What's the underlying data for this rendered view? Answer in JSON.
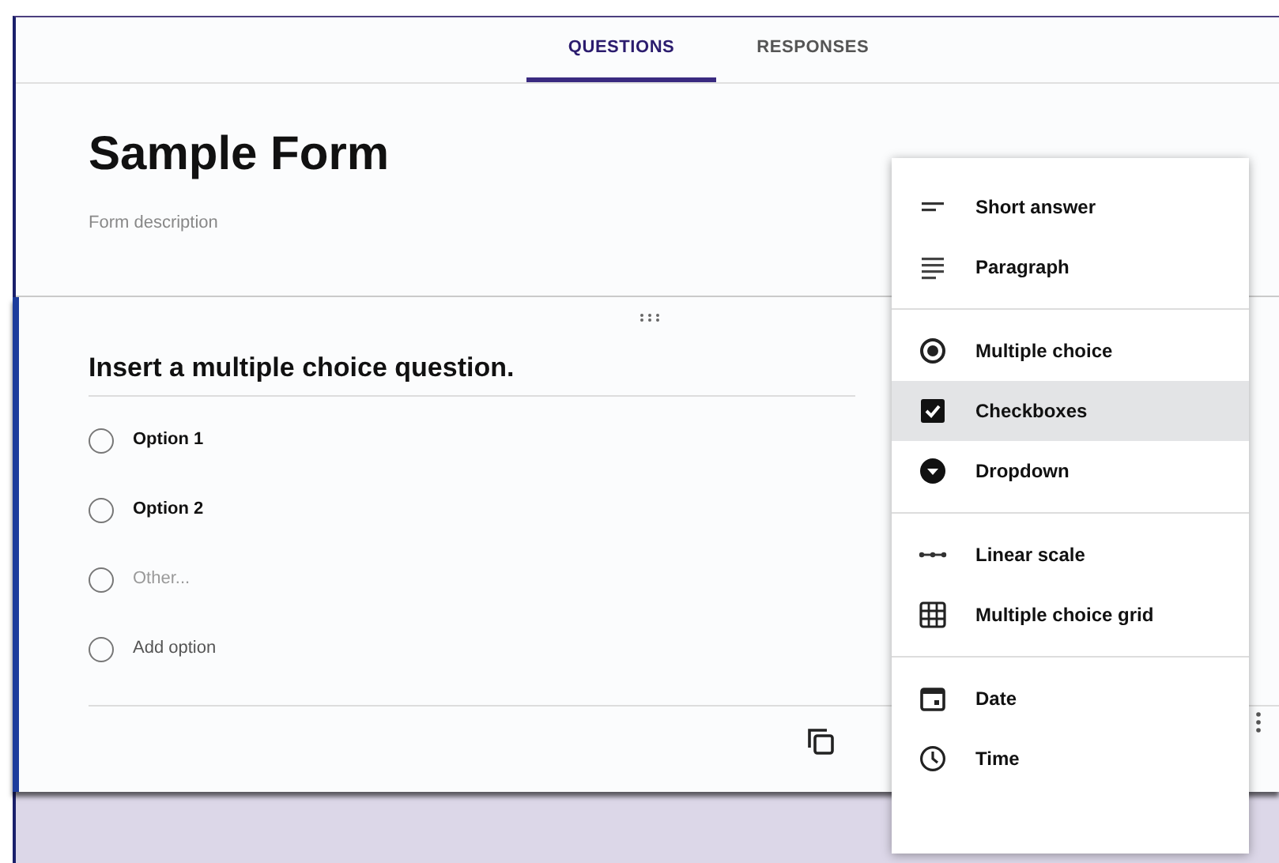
{
  "tabs": [
    {
      "label": "QUESTIONS",
      "selected": true
    },
    {
      "label": "RESPONSES",
      "selected": false
    }
  ],
  "form": {
    "title": "Sample Form",
    "description": "Form description"
  },
  "question": {
    "title": "Insert a multiple choice question.",
    "options": [
      {
        "label": "Option 1",
        "kind": "option",
        "checked": false
      },
      {
        "label": "Option 2",
        "kind": "option",
        "checked": false
      },
      {
        "label": "Other...",
        "kind": "other",
        "checked": false
      },
      {
        "label": "Add option",
        "kind": "add",
        "checked": false
      }
    ]
  },
  "menu": {
    "groups": [
      [
        {
          "label": "Short answer",
          "kind": "short",
          "selected": false
        },
        {
          "label": "Paragraph",
          "kind": "paragraph",
          "selected": false
        }
      ],
      [
        {
          "label": "Multiple choice",
          "kind": "radio",
          "selected": false
        },
        {
          "label": "Checkboxes",
          "kind": "checkbox",
          "selected": true
        },
        {
          "label": "Dropdown",
          "kind": "dropdown",
          "selected": false
        }
      ],
      [
        {
          "label": "Linear scale",
          "kind": "scale",
          "selected": false
        },
        {
          "label": "Multiple choice grid",
          "kind": "grid",
          "selected": false
        }
      ],
      [
        {
          "label": "Date",
          "kind": "date",
          "selected": false
        },
        {
          "label": "Time",
          "kind": "time",
          "selected": false
        }
      ]
    ]
  }
}
